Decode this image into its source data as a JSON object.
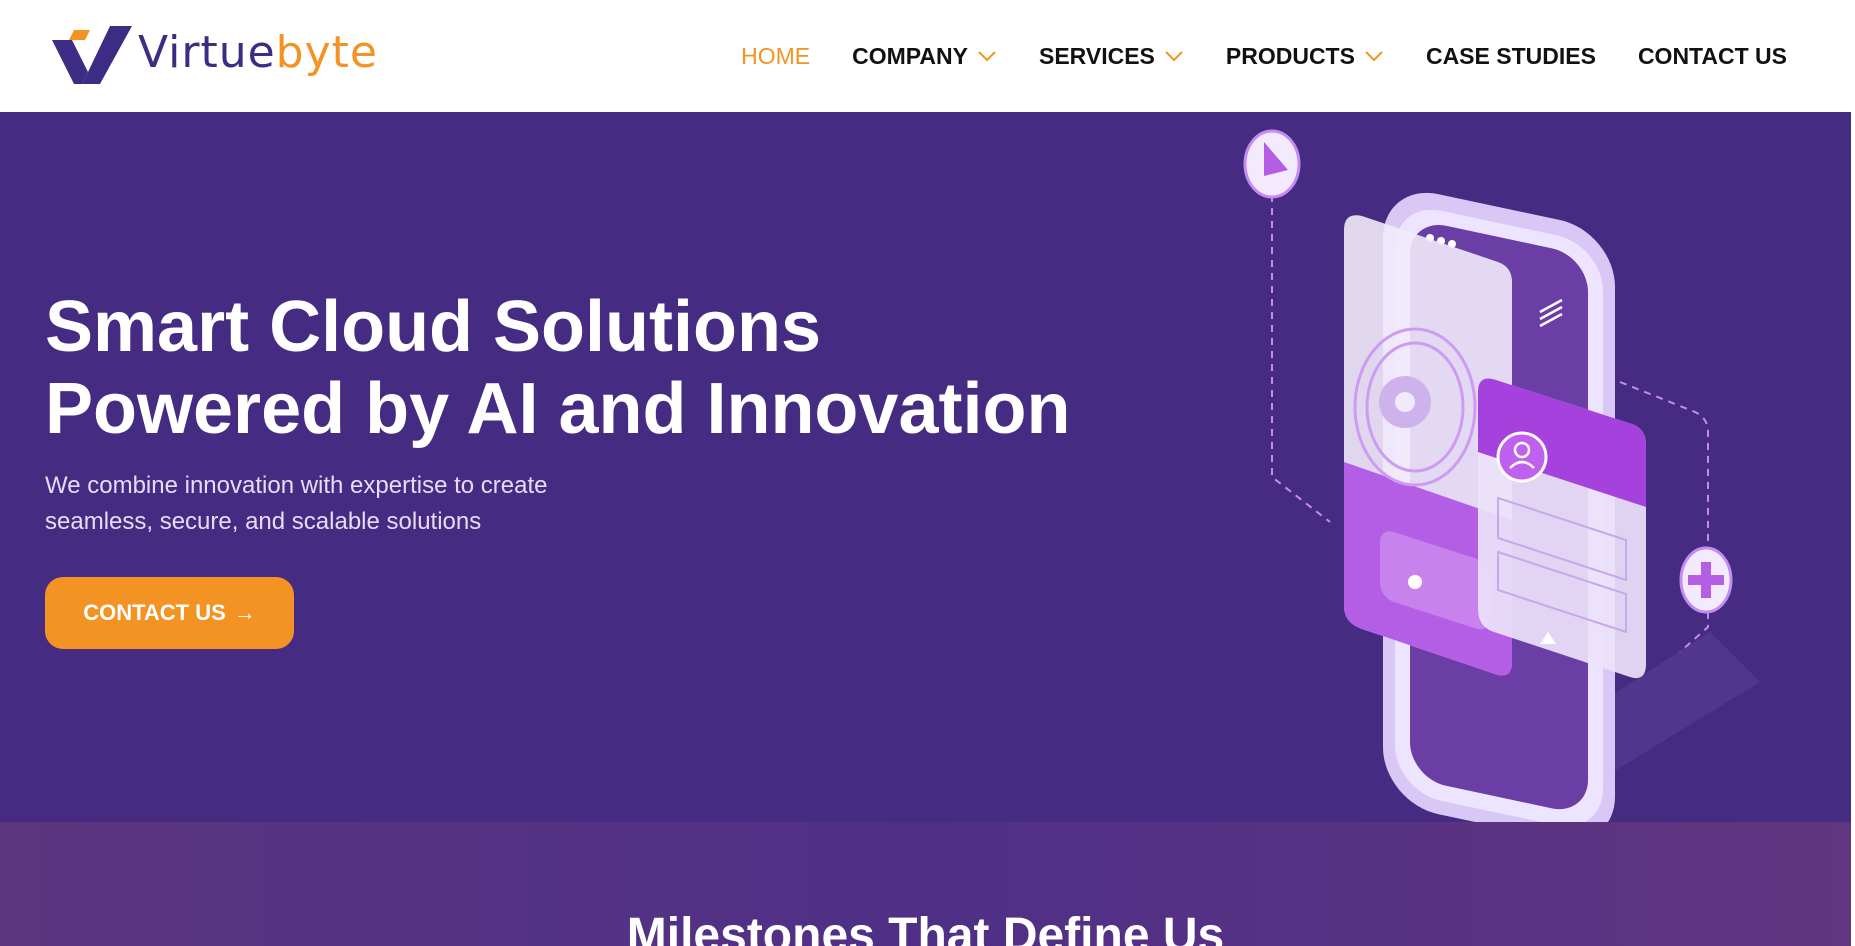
{
  "brand": {
    "name_part1": "Virtue",
    "name_part2": "byte",
    "colors": {
      "primary": "#3d2c83",
      "accent": "#f39323"
    }
  },
  "nav": {
    "items": [
      {
        "label": "HOME",
        "active": true,
        "dropdown": false
      },
      {
        "label": "COMPANY",
        "active": false,
        "dropdown": true
      },
      {
        "label": "SERVICES",
        "active": false,
        "dropdown": true
      },
      {
        "label": "PRODUCTS",
        "active": false,
        "dropdown": true
      },
      {
        "label": "CASE STUDIES",
        "active": false,
        "dropdown": false
      },
      {
        "label": "CONTACT US",
        "active": false,
        "dropdown": false
      }
    ]
  },
  "hero": {
    "title": "Smart Cloud Solutions Powered by AI and Innovation",
    "subtitle_line1": "We combine innovation with expertise to create",
    "subtitle_line2": "seamless, secure, and scalable solutions",
    "cta_label": "CONTACT US",
    "cta_arrow": "→",
    "background": "#452c82"
  },
  "milestones": {
    "heading": "Milestones That Define Us"
  }
}
